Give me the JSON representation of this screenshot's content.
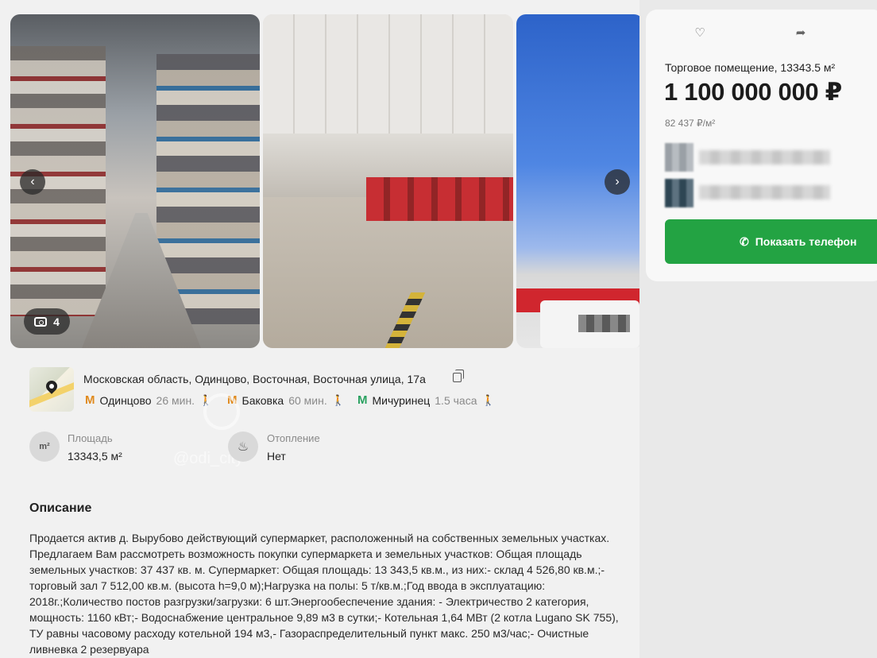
{
  "gallery": {
    "photo_count": "4",
    "prev_icon": "chevron-left-icon",
    "next_icon": "chevron-right-icon",
    "camera_icon": "camera-icon"
  },
  "address": {
    "text": "Московская область, Одинцово, Восточная, Восточная улица, 17а",
    "copy_icon": "copy-icon",
    "metro": [
      {
        "name": "Одинцово",
        "time": "26 мин.",
        "color": "#e08a1e",
        "symbol": "M"
      },
      {
        "name": "Баковка",
        "time": "60 мин.",
        "color": "#e08a1e",
        "symbol": "M"
      },
      {
        "name": "Мичуринец",
        "time": "1.5 часа",
        "color": "#2aa160",
        "symbol": "M"
      }
    ]
  },
  "features": {
    "area_label": "Площадь",
    "area_value": "13343,5 м²",
    "area_icon_text": "m²",
    "heating_label": "Отопление",
    "heating_value": "Нет",
    "heating_icon_text": "♨"
  },
  "watermark": {
    "text": "@odi_city"
  },
  "description": {
    "title": "Описание",
    "text": "Продается актив д. Вырубово действующий супермаркет, расположенный на собственных земельных участках. Предлагаем Вам рассмотреть возможность покупки супермаркета и земельных участков: Общая площадь земельных участков: 37 437 кв. м. Супермаркет: Общая площадь: 13 343,5 кв.м., из них:- склад 4 526,80 кв.м.;- торговый зал 7 512,00 кв.м. (высота h=9,0 м);Нагрузка на полы: 5 т/кв.м.;Год ввода в эксплуатацию: 2018г.;Количество постов разгрузки/загрузки: 6 шт.Энергообеспечение здания: - Электричество 2 категория, мощность: 1160 кВт;- Водоснабжение центральное 9,89 м3 в сутки;- Котельная 1,64 МВт (2 котла Lugano SK 755), ТУ равны часовому расходу котельной 194 м3,- Газораспределительный пункт макс. 250 м3/час;- Очистные ливневка 2 резервуара"
  },
  "card": {
    "favorite_icon": "heart-icon",
    "share_icon": "share-icon",
    "kind": "Торговое помещение, 13343.5 м²",
    "price": "1 100 000 000 ₽",
    "price_per_m2": "82 437 ₽/м²",
    "phone_button": "Показать телефон",
    "accent": "#23a343"
  }
}
